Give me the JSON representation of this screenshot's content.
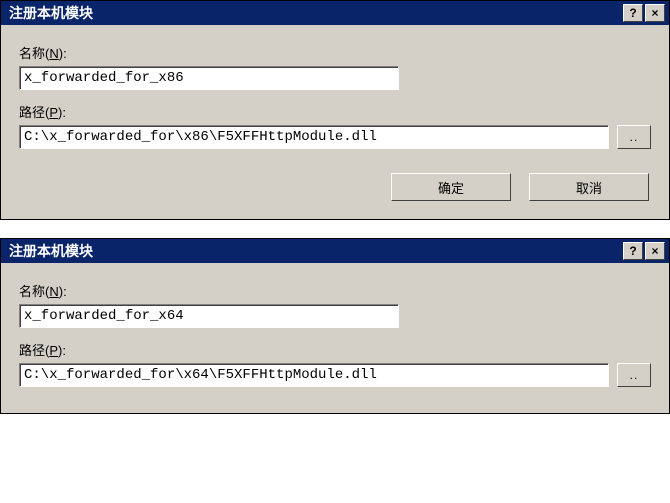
{
  "dialog1": {
    "title": "注册本机模块",
    "nameLabelPrefix": "名称(",
    "nameLabelKey": "N",
    "nameLabelSuffix": "):",
    "nameValue": "x_forwarded_for_x86",
    "pathLabelPrefix": "路径(",
    "pathLabelKey": "P",
    "pathLabelSuffix": "):",
    "pathValue": "C:\\x_forwarded_for\\x86\\F5XFFHttpModule.dll",
    "browseLabel": "..",
    "okLabel": "确定",
    "cancelLabel": "取消",
    "helpLabel": "?",
    "closeLabel": "×"
  },
  "dialog2": {
    "title": "注册本机模块",
    "nameLabelPrefix": "名称(",
    "nameLabelKey": "N",
    "nameLabelSuffix": "):",
    "nameValue": "x_forwarded_for_x64",
    "pathLabelPrefix": "路径(",
    "pathLabelKey": "P",
    "pathLabelSuffix": "):",
    "pathValue": "C:\\x_forwarded_for\\x64\\F5XFFHttpModule.dll",
    "browseLabel": "..",
    "helpLabel": "?",
    "closeLabel": "×"
  }
}
